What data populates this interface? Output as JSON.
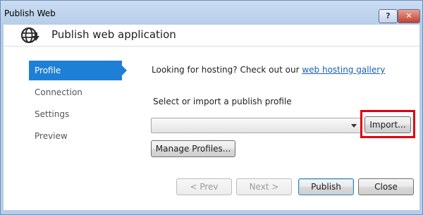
{
  "window": {
    "title": "Publish Web",
    "help_label": "?",
    "close_label": "✕"
  },
  "header": {
    "title": "Publish web application",
    "icon": "globe-icon"
  },
  "nav": {
    "items": [
      {
        "label": "Profile",
        "active": true
      },
      {
        "label": "Connection",
        "active": false
      },
      {
        "label": "Settings",
        "active": false
      },
      {
        "label": "Preview",
        "active": false
      }
    ]
  },
  "main": {
    "hosting_text": "Looking for hosting? Check out our ",
    "hosting_link": "web hosting gallery",
    "select_label": "Select or import a publish profile",
    "profile_value": "",
    "import_label": "Import...",
    "manage_label": "Manage Profiles..."
  },
  "footer": {
    "prev_label": "< Prev",
    "next_label": "Next >",
    "publish_label": "Publish",
    "close_label": "Close"
  },
  "colors": {
    "accent": "#1e7fd6",
    "highlight": "#e00012",
    "link": "#1a5fb4"
  }
}
